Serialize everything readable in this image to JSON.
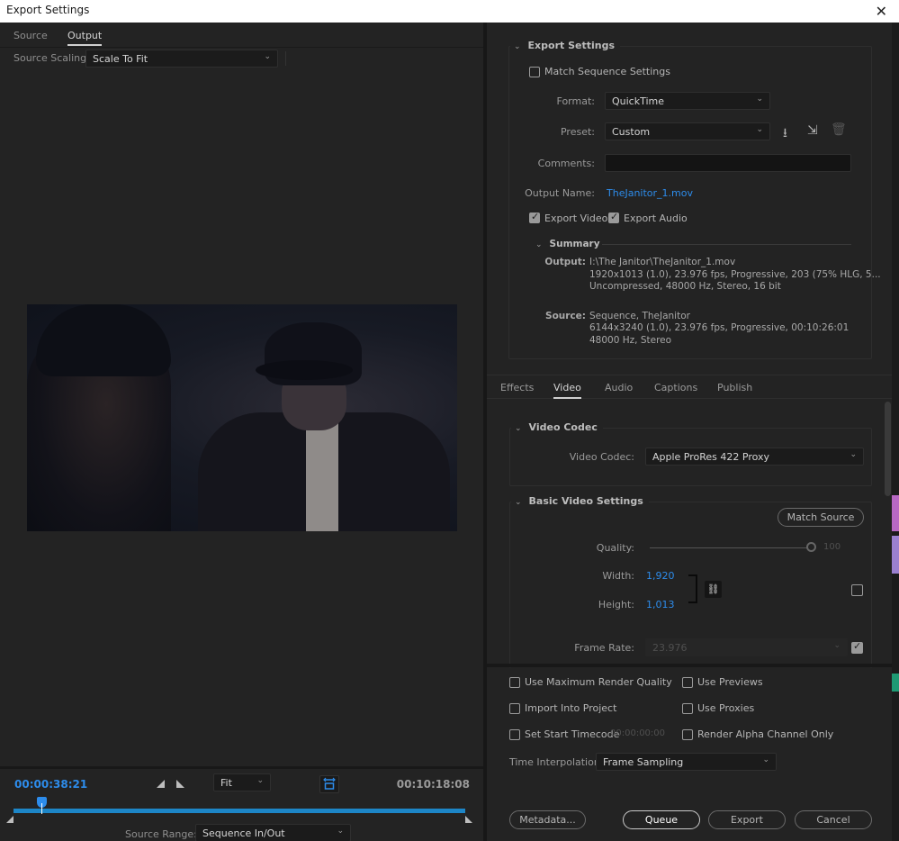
{
  "window": {
    "title": "Export Settings",
    "close_icon": "✕"
  },
  "left": {
    "tabs": [
      {
        "label": "Source",
        "active": false
      },
      {
        "label": "Output",
        "active": true
      }
    ],
    "source_scaling": {
      "label": "Source Scaling:",
      "value": "Scale To Fit"
    },
    "timeline": {
      "current_timecode": "00:00:38:21",
      "duration_timecode": "00:10:18:08",
      "zoom": "Fit",
      "playhead_fraction": 0.062,
      "source_range": {
        "label": "Source Range:",
        "value": "Sequence In/Out"
      }
    }
  },
  "export_settings": {
    "title": "Export Settings",
    "match_sequence": {
      "label": "Match Sequence Settings",
      "checked": false
    },
    "format": {
      "label": "Format:",
      "value": "QuickTime"
    },
    "preset": {
      "label": "Preset:",
      "value": "Custom"
    },
    "comments": {
      "label": "Comments:",
      "value": ""
    },
    "output_name": {
      "label": "Output Name:",
      "value": "TheJanitor_1.mov"
    },
    "export_video": {
      "label": "Export Video",
      "checked": true
    },
    "export_audio": {
      "label": "Export Audio",
      "checked": true
    },
    "summary": {
      "title": "Summary",
      "output_key": "Output:",
      "output_lines": [
        "I:\\The Janitor\\TheJanitor_1.mov",
        "1920x1013 (1.0), 23.976 fps, Progressive, 203 (75% HLG, 5...",
        "Uncompressed, 48000 Hz, Stereo, 16 bit"
      ],
      "source_key": "Source:",
      "source_lines": [
        "Sequence, TheJanitor",
        "6144x3240 (1.0), 23.976 fps, Progressive, 00:10:26:01",
        "48000 Hz, Stereo"
      ]
    }
  },
  "settings_tabs": [
    {
      "label": "Effects",
      "active": false
    },
    {
      "label": "Video",
      "active": true
    },
    {
      "label": "Audio",
      "active": false
    },
    {
      "label": "Captions",
      "active": false
    },
    {
      "label": "Publish",
      "active": false
    }
  ],
  "video_codec": {
    "title": "Video Codec",
    "label": "Video Codec:",
    "value": "Apple ProRes 422 Proxy"
  },
  "basic_video": {
    "title": "Basic Video Settings",
    "match_source": "Match Source",
    "quality": {
      "label": "Quality:",
      "value": "100",
      "fraction": 1.0
    },
    "width": {
      "label": "Width:",
      "value": "1,920"
    },
    "height": {
      "label": "Height:",
      "value": "1,013"
    },
    "override_checked": false,
    "frame_rate": {
      "label": "Frame Rate:",
      "value": "23.976",
      "override_checked": true
    }
  },
  "options": {
    "max_render_quality": {
      "label": "Use Maximum Render Quality",
      "checked": false
    },
    "use_previews": {
      "label": "Use Previews",
      "checked": false
    },
    "import_into_project": {
      "label": "Import Into Project",
      "checked": false
    },
    "use_proxies": {
      "label": "Use Proxies",
      "checked": false
    },
    "set_start_timecode": {
      "label": "Set Start Timecode",
      "checked": false,
      "value": "00:00:00:00"
    },
    "render_alpha": {
      "label": "Render Alpha Channel Only",
      "checked": false
    },
    "time_interpolation": {
      "label": "Time Interpolation:",
      "value": "Frame Sampling"
    }
  },
  "buttons": {
    "metadata": "Metadata...",
    "queue": "Queue",
    "export": "Export",
    "cancel": "Cancel"
  },
  "icons": {
    "chevron_down": "⌄",
    "save_preset": "⭳",
    "import_preset": "⇲",
    "delete_preset": "🗑",
    "chain": "⛓"
  }
}
